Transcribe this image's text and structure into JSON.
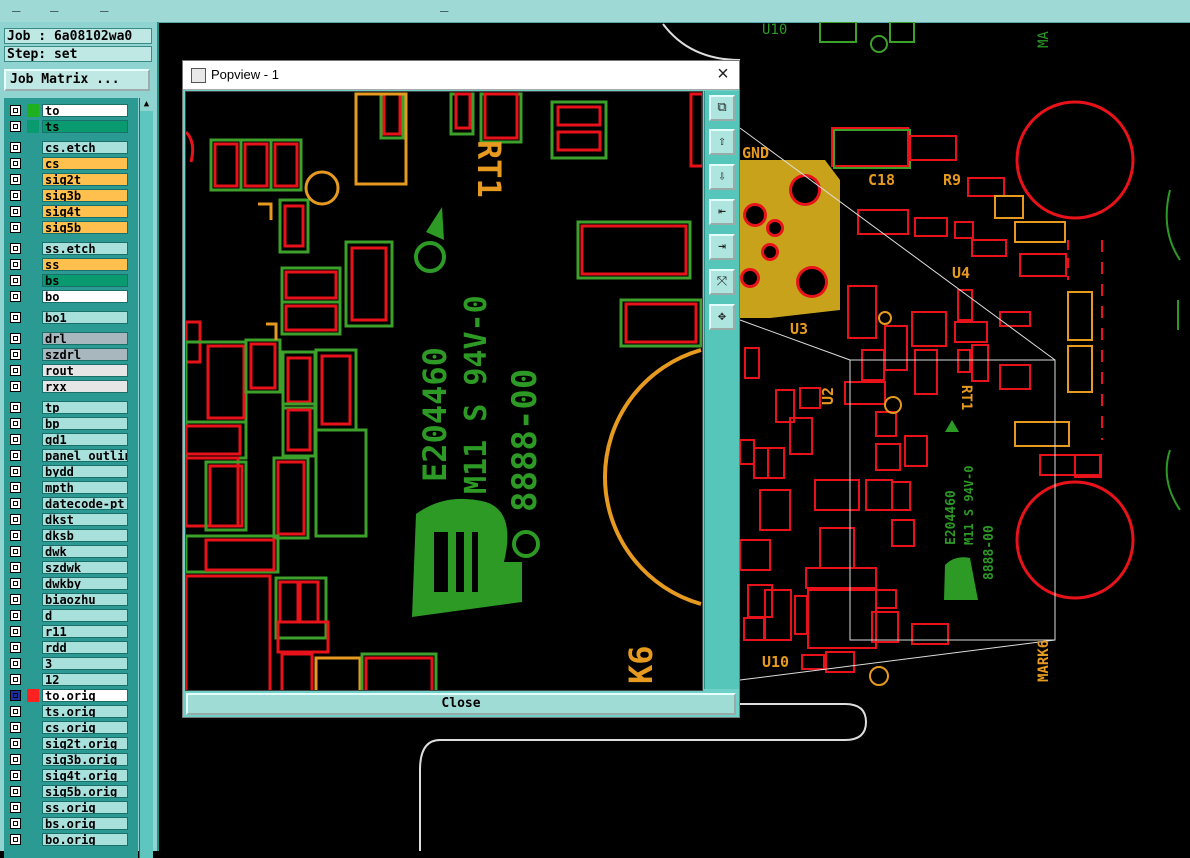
{
  "job_label": "Job : 6a08102wa0",
  "step_label": "Step: set",
  "job_matrix_button": "Job Matrix ...",
  "layers": [
    {
      "name": "to",
      "bg": "#ffffff",
      "color": "#1eb01e"
    },
    {
      "name": "ts",
      "bg": "#0a9a70",
      "color": "#0a9a70"
    },
    {
      "name": "cs.etch",
      "bg": "#a8e0dc",
      "color": "",
      "gap": true
    },
    {
      "name": "cs",
      "bg": "#ffc04d",
      "color": ""
    },
    {
      "name": "sig2t",
      "bg": "#ffc04d",
      "color": ""
    },
    {
      "name": "sig3b",
      "bg": "#ffc04d",
      "color": ""
    },
    {
      "name": "sig4t",
      "bg": "#ffc04d",
      "color": ""
    },
    {
      "name": "sig5b",
      "bg": "#ffc04d",
      "color": ""
    },
    {
      "name": "ss.etch",
      "bg": "#a8e0dc",
      "color": "",
      "gap": true
    },
    {
      "name": "ss",
      "bg": "#ffc04d",
      "color": ""
    },
    {
      "name": "bs",
      "bg": "#0a9a70",
      "color": ""
    },
    {
      "name": "bo",
      "bg": "#ffffff",
      "color": ""
    },
    {
      "name": "bo1",
      "bg": "#a8e0dc",
      "color": "",
      "gap": true
    },
    {
      "name": "drl",
      "bg": "#a8b6bd",
      "color": "",
      "gap": true
    },
    {
      "name": "szdrl",
      "bg": "#a8b6bd",
      "color": ""
    },
    {
      "name": "rout",
      "bg": "#e6e6e6",
      "color": ""
    },
    {
      "name": "rxx",
      "bg": "#e6e6e6",
      "color": ""
    },
    {
      "name": "tp",
      "bg": "#a8e0dc",
      "color": "",
      "gap": true
    },
    {
      "name": "bp",
      "bg": "#a8e0dc",
      "color": ""
    },
    {
      "name": "gd1",
      "bg": "#a8e0dc",
      "color": ""
    },
    {
      "name": "panel_outline",
      "bg": "#a8e0dc",
      "color": ""
    },
    {
      "name": "bydd",
      "bg": "#a8e0dc",
      "color": ""
    },
    {
      "name": "mpth",
      "bg": "#a8e0dc",
      "color": ""
    },
    {
      "name": "datecode-pt",
      "bg": "#a8e0dc",
      "color": ""
    },
    {
      "name": "dkst",
      "bg": "#a8e0dc",
      "color": ""
    },
    {
      "name": "dksb",
      "bg": "#a8e0dc",
      "color": ""
    },
    {
      "name": "dwk",
      "bg": "#a8e0dc",
      "color": ""
    },
    {
      "name": "szdwk",
      "bg": "#a8e0dc",
      "color": ""
    },
    {
      "name": "dwkby",
      "bg": "#a8e0dc",
      "color": ""
    },
    {
      "name": "biaozhu",
      "bg": "#a8e0dc",
      "color": ""
    },
    {
      "name": "d",
      "bg": "#a8e0dc",
      "color": ""
    },
    {
      "name": "r11",
      "bg": "#a8e0dc",
      "color": ""
    },
    {
      "name": "rdd",
      "bg": "#a8e0dc",
      "color": ""
    },
    {
      "name": "3",
      "bg": "#a8e0dc",
      "color": ""
    },
    {
      "name": "12",
      "bg": "#a8e0dc",
      "color": ""
    },
    {
      "name": "to.orig",
      "bg": "#ffffff",
      "color": "#ff2020",
      "active": true
    },
    {
      "name": "ts.orig",
      "bg": "#a8e0dc",
      "color": ""
    },
    {
      "name": "cs.orig",
      "bg": "#a8e0dc",
      "color": ""
    },
    {
      "name": "sig2t.orig",
      "bg": "#a8e0dc",
      "color": ""
    },
    {
      "name": "sig3b.orig",
      "bg": "#a8e0dc",
      "color": ""
    },
    {
      "name": "sig4t.orig",
      "bg": "#a8e0dc",
      "color": ""
    },
    {
      "name": "sig5b.orig",
      "bg": "#a8e0dc",
      "color": ""
    },
    {
      "name": "ss.orig",
      "bg": "#a8e0dc",
      "color": ""
    },
    {
      "name": "bs.orig",
      "bg": "#a8e0dc",
      "color": ""
    },
    {
      "name": "bo.orig",
      "bg": "#a8e0dc",
      "color": ""
    }
  ],
  "popup": {
    "title": "Popview - 1",
    "close_label": "Close",
    "toolbar_icons": [
      "zoom-window-icon",
      "layer-up-icon",
      "layer-down-icon",
      "pan-left-icon",
      "pan-right-icon",
      "zoom-fit-icon",
      "zoom-in-icon"
    ]
  },
  "pcb_text": {
    "rt1": "RT1",
    "ul_code": "E204460",
    "grade": "M11 S 94V-0",
    "date": "8888-00",
    "k6": "K6",
    "gnd": "GND",
    "c18": "C18",
    "r9": "R9",
    "u4": "U4",
    "u3": "U3",
    "u2": "U2",
    "u10": "U10",
    "rt1_small": "RT1",
    "ul_small": "E204460",
    "grade_small": "M11 S 94V-0",
    "date_small": "8888-00",
    "mark6": "MARK6",
    "u10_top": "U10",
    "ma_top": "MA"
  },
  "colors": {
    "pad_red": "#e8121a",
    "outline_green": "#3da02a",
    "silk_green": "#2c9a24",
    "silk_orange": "#e69a1f",
    "copper": "#c9a21c",
    "ui_teal": "#8fd4d0"
  }
}
